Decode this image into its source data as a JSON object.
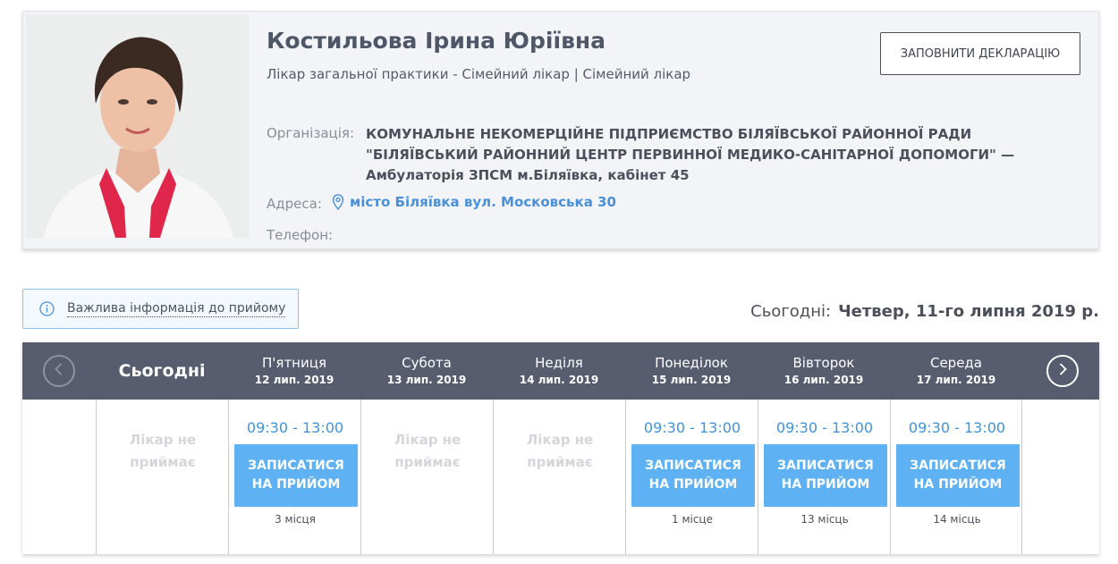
{
  "doctor": {
    "name": "Костильова Ірина Юріївна",
    "specialty": "Лікар загальної практики - Сімейний лікар | Сімейний лікар",
    "declaration_button": "ЗАПОВНИТИ ДЕКЛАРАЦІЮ",
    "organization_label": "Організація:",
    "organization": "КОМУНАЛЬНЕ НЕКОМЕРЦІЙНЕ ПІДПРИЄМСТВО БІЛЯЇВСЬКОЇ РАЙОННОЇ РАДИ \"БІЛЯЇВСЬКИЙ РАЙОННИЙ ЦЕНТР ПЕРВИННОЇ МЕДИКО-САНІТАРНОЇ ДОПОМОГИ\" — Амбулаторія ЗПСМ м.Біляївка, кабінет 45",
    "address_label": "Адреса:",
    "address": "місто Біляївка вул. Московська 30",
    "phone_label": "Телефон:"
  },
  "important_info": "Важлива інформація до прийому",
  "today": {
    "label": "Сьогодні:",
    "date": "Четвер, 11-го липня 2019 р."
  },
  "schedule": {
    "today_header": "Сьогодні",
    "days": [
      {
        "day": "",
        "date": "",
        "status": "Лікар не приймає"
      },
      {
        "day": "П'ятниця",
        "date": "12 лип. 2019",
        "time": "09:30 - 13:00",
        "button": "ЗАПИСАТИСЯ НА ПРИЙОМ",
        "places": "3 місця"
      },
      {
        "day": "Субота",
        "date": "13 лип. 2019",
        "status": "Лікар не приймає"
      },
      {
        "day": "Неділя",
        "date": "14 лип. 2019",
        "status": "Лікар не приймає"
      },
      {
        "day": "Понеділок",
        "date": "15 лип. 2019",
        "time": "09:30 - 13:00",
        "button": "ЗАПИСАТИСЯ НА ПРИЙОМ",
        "places": "1 місце"
      },
      {
        "day": "Вівторок",
        "date": "16 лип. 2019",
        "time": "09:30 - 13:00",
        "button": "ЗАПИСАТИСЯ НА ПРИЙОМ",
        "places": "13 місць"
      },
      {
        "day": "Середа",
        "date": "17 лип. 2019",
        "time": "09:30 - 13:00",
        "button": "ЗАПИСАТИСЯ НА ПРИЙОМ",
        "places": "14 місць"
      }
    ]
  },
  "icons": {
    "prev": "chevron-left-icon",
    "next": "chevron-right-icon",
    "info": "info-icon",
    "address": "map-pin-icon"
  },
  "colors": {
    "accent": "#5eb1f2",
    "link": "#4a90d9",
    "header_bg": "#575c6e",
    "muted": "#d3d6db"
  }
}
